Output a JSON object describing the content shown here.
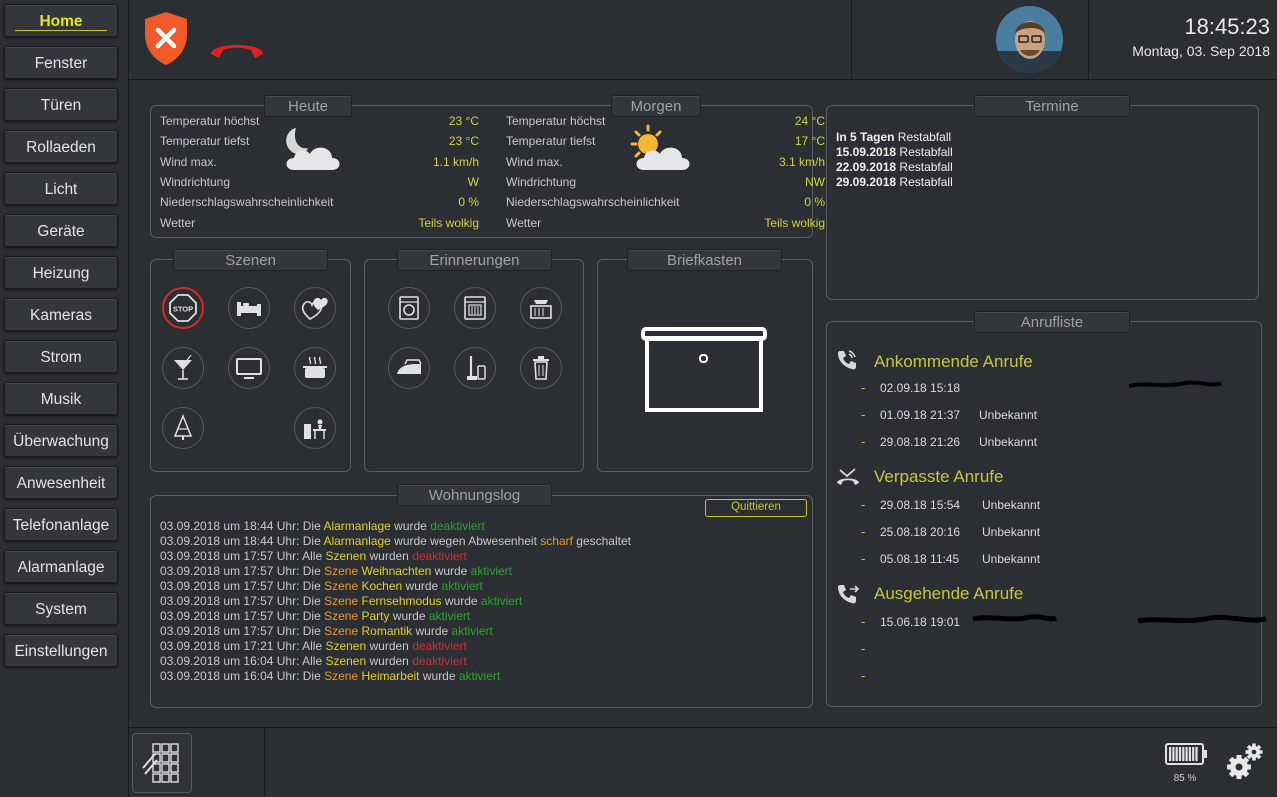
{
  "nav": [
    "Home",
    "Fenster",
    "Türen",
    "Rollaeden",
    "Licht",
    "Geräte",
    "Heizung",
    "Kameras",
    "Strom",
    "Musik",
    "Überwachung",
    "Anwesenheit",
    "Telefonanlage",
    "Alarmanlage",
    "System",
    "Einstellungen"
  ],
  "header": {
    "time": "18:45:23",
    "date": "Montag, 03. Sep 2018"
  },
  "today": {
    "title": "Heute",
    "rows": [
      {
        "label": "Temperatur höchst",
        "value": "23 °C"
      },
      {
        "label": "Temperatur tiefst",
        "value": "23 °C"
      },
      {
        "label": "Wind max.",
        "value": "1.1 km/h"
      },
      {
        "label": "Windrichtung",
        "value": "W"
      },
      {
        "label": "Niederschlagswahrscheinlichkeit",
        "value": "0 %"
      },
      {
        "label": "Wetter",
        "value": "Teils wolkig"
      }
    ]
  },
  "tomorrow": {
    "title": "Morgen",
    "rows": [
      {
        "label": "Temperatur höchst",
        "value": "24 °C"
      },
      {
        "label": "Temperatur tiefst",
        "value": "17 °C"
      },
      {
        "label": "Wind max.",
        "value": "3.1 km/h"
      },
      {
        "label": "Windrichtung",
        "value": "NW"
      },
      {
        "label": "Niederschlagswahrscheinlichkeit",
        "value": "0 %"
      },
      {
        "label": "Wetter",
        "value": "Teils wolkig"
      }
    ]
  },
  "panels": {
    "szenen": "Szenen",
    "erinnerungen": "Erinnerungen",
    "briefkasten": "Briefkasten",
    "wohnungslog": "Wohnungslog",
    "termine": "Termine",
    "anrufliste": "Anrufliste"
  },
  "scene_stop_label": "STOP",
  "termine": [
    {
      "date": "In 5 Tagen",
      "text": " Restabfall"
    },
    {
      "date": "15.09.2018",
      "text": " Restabfall"
    },
    {
      "date": "22.09.2018",
      "text": " Restabfall"
    },
    {
      "date": "29.09.2018",
      "text": " Restabfall"
    }
  ],
  "log": {
    "ack_label": "Quittieren",
    "lines": [
      [
        [
          "03.09.2018 um 18:44 Uhr: Die ",
          ""
        ],
        [
          "Alarmanlage",
          "y"
        ],
        [
          " wurde ",
          ""
        ],
        [
          "deaktiviert",
          "g"
        ]
      ],
      [
        [
          "03.09.2018 um 18:44 Uhr: Die ",
          ""
        ],
        [
          "Alarmanlage",
          "y"
        ],
        [
          " wurde wegen Abwesenheit ",
          ""
        ],
        [
          "scharf",
          "o"
        ],
        [
          " geschaltet",
          ""
        ]
      ],
      [
        [
          "03.09.2018 um 17:57 Uhr: Alle ",
          ""
        ],
        [
          "Szenen",
          "y"
        ],
        [
          " wurden ",
          ""
        ],
        [
          "deaktiviert",
          "r"
        ]
      ],
      [
        [
          "03.09.2018 um 17:57 Uhr: Die ",
          ""
        ],
        [
          "Szene",
          "o"
        ],
        [
          " ",
          ""
        ],
        [
          "Weihnachten",
          "y"
        ],
        [
          " wurde ",
          ""
        ],
        [
          "aktiviert",
          "g"
        ]
      ],
      [
        [
          "03.09.2018 um 17:57 Uhr: Die ",
          ""
        ],
        [
          "Szene",
          "o"
        ],
        [
          " ",
          ""
        ],
        [
          "Kochen",
          "y"
        ],
        [
          " wurde ",
          ""
        ],
        [
          "aktiviert",
          "g"
        ]
      ],
      [
        [
          "03.09.2018 um 17:57 Uhr: Die ",
          ""
        ],
        [
          "Szene",
          "o"
        ],
        [
          " ",
          ""
        ],
        [
          "Fernsehmodus",
          "y"
        ],
        [
          " wurde ",
          ""
        ],
        [
          "aktiviert",
          "g"
        ]
      ],
      [
        [
          "03.09.2018 um 17:57 Uhr: Die ",
          ""
        ],
        [
          "Szene",
          "o"
        ],
        [
          " ",
          ""
        ],
        [
          "Party",
          "y"
        ],
        [
          " wurde ",
          ""
        ],
        [
          "aktiviert",
          "g"
        ]
      ],
      [
        [
          "03.09.2018 um 17:57 Uhr: Die ",
          ""
        ],
        [
          "Szene",
          "o"
        ],
        [
          " ",
          ""
        ],
        [
          "Romantik",
          "y"
        ],
        [
          " wurde ",
          ""
        ],
        [
          "aktiviert",
          "g"
        ]
      ],
      [
        [
          "03.09.2018 um 17:21 Uhr: Alle ",
          ""
        ],
        [
          "Szenen",
          "y"
        ],
        [
          " wurden ",
          ""
        ],
        [
          "deaktiviert",
          "r"
        ]
      ],
      [
        [
          "03.09.2018 um 16:04 Uhr: Alle ",
          ""
        ],
        [
          "Szenen",
          "y"
        ],
        [
          " wurden ",
          ""
        ],
        [
          "deaktiviert",
          "r"
        ]
      ],
      [
        [
          "03.09.2018 um 16:04 Uhr: Die ",
          ""
        ],
        [
          "Szene",
          "o"
        ],
        [
          " ",
          ""
        ],
        [
          "Heimarbeit",
          "y"
        ],
        [
          " wurde ",
          ""
        ],
        [
          "aktiviert",
          "g"
        ]
      ]
    ]
  },
  "calls": {
    "incoming": {
      "title": "Ankommende Anrufe",
      "rows": [
        {
          "time": "02.09.18 15:18",
          "name": ""
        },
        {
          "time": "01.09.18 21:37",
          "name": "Unbekannt"
        },
        {
          "time": "29.08.18 21:26",
          "name": "Unbekannt"
        }
      ]
    },
    "missed": {
      "title": "Verpasste Anrufe",
      "rows": [
        {
          "time": "29.08.18 15:54",
          "name": "Unbekannt"
        },
        {
          "time": "25.08.18 20:16",
          "name": "Unbekannt"
        },
        {
          "time": "05.08.18 11:45",
          "name": "Unbekannt"
        }
      ]
    },
    "outgoing": {
      "title": "Ausgehende Anrufe",
      "rows": [
        {
          "time": "15.06.18 19:01",
          "name": ""
        },
        {
          "time": "",
          "name": ""
        },
        {
          "time": "",
          "name": ""
        }
      ]
    }
  },
  "battery": "85 %",
  "colors": {
    "accent": "#d4d43a",
    "alarm": "#f05a28",
    "phone_red": "#e01f1f",
    "active_green": "#2da42d",
    "inactive_red": "#cc3030"
  }
}
